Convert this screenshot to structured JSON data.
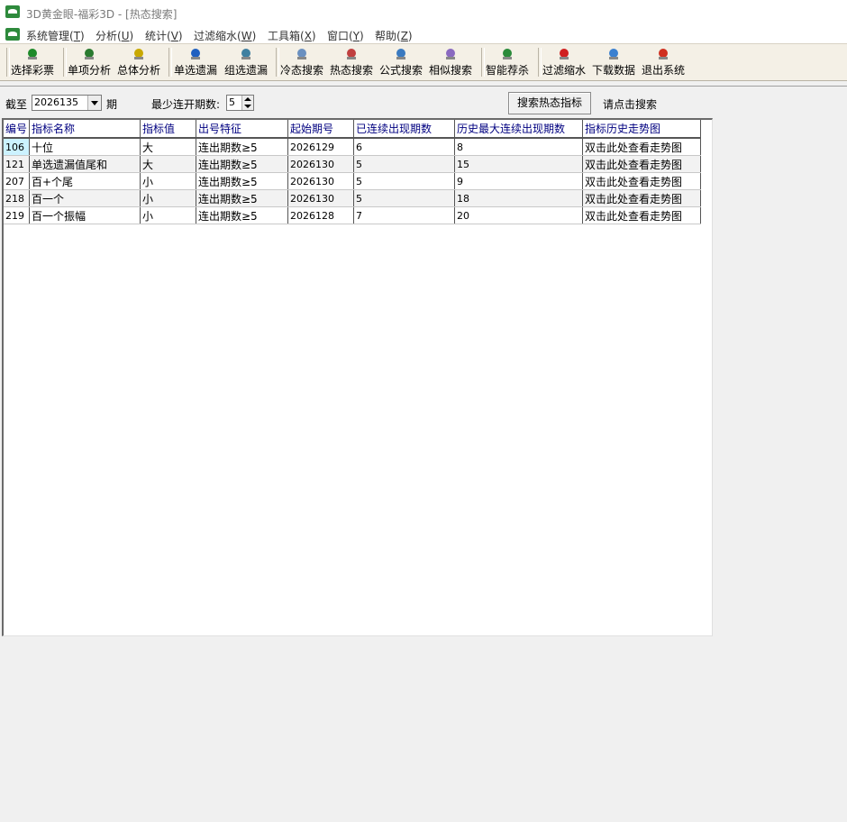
{
  "window": {
    "title": "3D黄金眼-福彩3D - [热态搜索]"
  },
  "menu": [
    {
      "label": "系统管理(",
      "acc": "T",
      "tail": ")"
    },
    {
      "label": "分析(",
      "acc": "U",
      "tail": ")"
    },
    {
      "label": "统计(",
      "acc": "V",
      "tail": ")"
    },
    {
      "label": "过滤缩水(",
      "acc": "W",
      "tail": ")"
    },
    {
      "label": "工具箱(",
      "acc": "X",
      "tail": ")"
    },
    {
      "label": "窗口(",
      "acc": "Y",
      "tail": ")"
    },
    {
      "label": "帮助(",
      "acc": "Z",
      "tail": ")"
    }
  ],
  "toolbar": [
    {
      "label": "选择彩票",
      "icon": "select-lottery-icon"
    },
    {
      "label": "单项分析",
      "icon": "single-analysis-icon"
    },
    {
      "label": "总体分析",
      "icon": "overall-analysis-icon"
    },
    {
      "label": "单选遗漏",
      "icon": "single-omission-icon"
    },
    {
      "label": "组选遗漏",
      "icon": "group-omission-icon"
    },
    {
      "label": "冷态搜索",
      "icon": "cold-search-icon"
    },
    {
      "label": "热态搜索",
      "icon": "hot-search-icon"
    },
    {
      "label": "公式搜索",
      "icon": "formula-search-icon"
    },
    {
      "label": "相似搜索",
      "icon": "similar-search-icon"
    },
    {
      "label": "智能荐杀",
      "icon": "smart-recommend-icon"
    },
    {
      "label": "过滤缩水",
      "icon": "filter-shrink-icon"
    },
    {
      "label": "下载数据",
      "icon": "download-data-icon"
    },
    {
      "label": "退出系统",
      "icon": "exit-system-icon"
    }
  ],
  "form": {
    "cutoff_label": "截至",
    "cutoff_value": "2026135",
    "period_label": "期",
    "min_label": "最少连开期数:",
    "min_value": "5",
    "search_button": "搜索热态指标",
    "hint": "请点击搜索"
  },
  "table": {
    "columns": [
      "编号",
      "指标名称",
      "指标值",
      "出号特征",
      "起始期号",
      "已连续出现期数",
      "历史最大连续出现期数",
      "指标历史走势图"
    ],
    "rows": [
      [
        "106",
        "十位",
        "大",
        "连出期数≥5",
        "2026129",
        "6",
        "8",
        "双击此处查看走势图"
      ],
      [
        "121",
        "单选遗漏值尾和",
        "大",
        "连出期数≥5",
        "2026130",
        "5",
        "15",
        "双击此处查看走势图"
      ],
      [
        "207",
        "百+个尾",
        "小",
        "连出期数≥5",
        "2026130",
        "5",
        "9",
        "双击此处查看走势图"
      ],
      [
        "218",
        "百一个",
        "小",
        "连出期数≥5",
        "2026130",
        "5",
        "18",
        "双击此处查看走势图"
      ],
      [
        "219",
        "百一个振幅",
        "小",
        "连出期数≥5",
        "2026128",
        "7",
        "20",
        "双击此处查看走势图"
      ]
    ]
  },
  "colors": {
    "header_text": "#000080",
    "selected_cell": "#ccf2ff",
    "toolbar_bg": "#f4f0e6"
  }
}
